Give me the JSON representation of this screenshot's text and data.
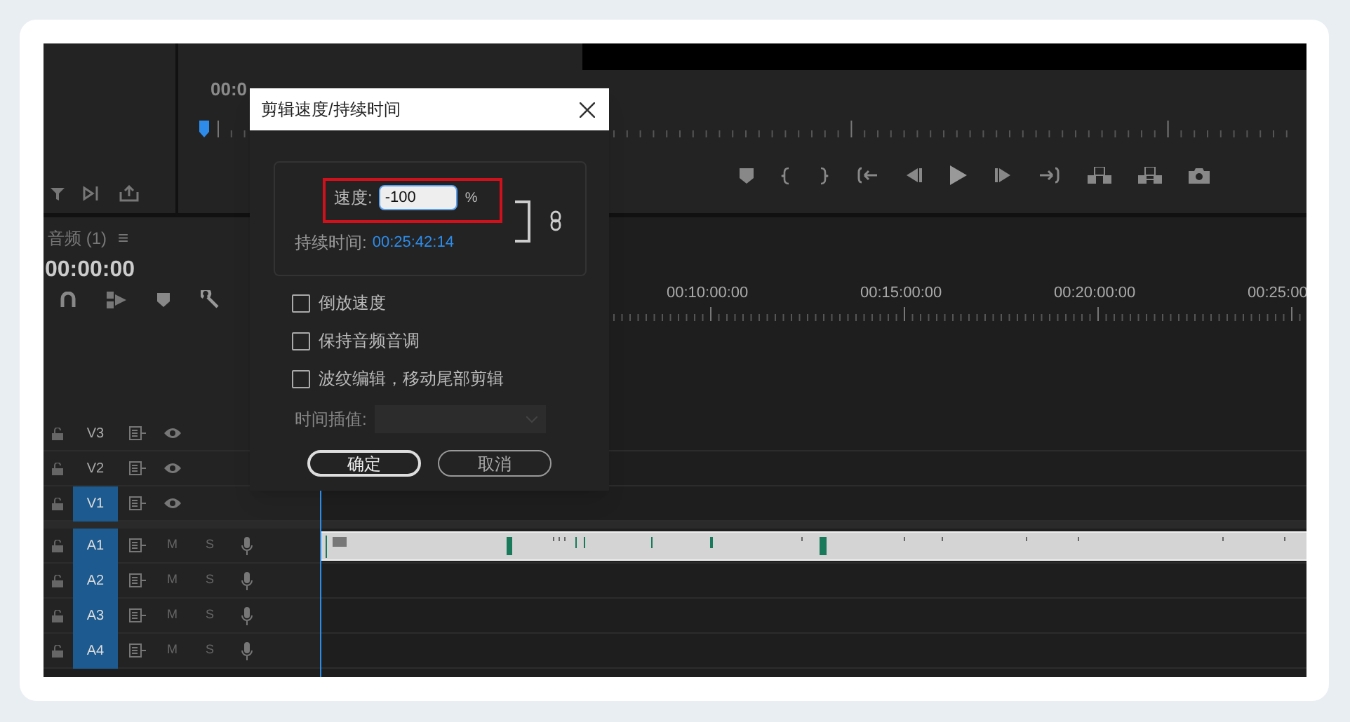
{
  "program_monitor": {
    "timecode": "00:0"
  },
  "timeline": {
    "tab_title": "音频 (1)",
    "menu_glyph": "≡",
    "timecode": "00:00:00",
    "ruler_labels": [
      "00:10:00:00",
      "00:15:00:00",
      "00:20:00:00",
      "00:25:00"
    ],
    "tracks": [
      {
        "name": "V3",
        "kind": "video",
        "selected": false
      },
      {
        "name": "V2",
        "kind": "video",
        "selected": false
      },
      {
        "name": "V1",
        "kind": "video",
        "selected": true
      },
      {
        "name": "A1",
        "kind": "audio",
        "selected": true,
        "mute": "M",
        "solo": "S"
      },
      {
        "name": "A2",
        "kind": "audio",
        "selected": true,
        "mute": "M",
        "solo": "S"
      },
      {
        "name": "A3",
        "kind": "audio",
        "selected": true,
        "mute": "M",
        "solo": "S"
      },
      {
        "name": "A4",
        "kind": "audio",
        "selected": true,
        "mute": "M",
        "solo": "S"
      }
    ]
  },
  "dialog": {
    "title": "剪辑速度/持续时间",
    "speed_label": "速度:",
    "speed_value": "-100",
    "speed_unit": "%",
    "duration_label": "持续时间:",
    "duration_value": "00:25:42:14",
    "options": [
      {
        "label": "倒放速度",
        "checked": false
      },
      {
        "label": "保持音频音调",
        "checked": false
      },
      {
        "label": "波纹编辑，移动尾部剪辑",
        "checked": false
      }
    ],
    "interpolation_label": "时间插值:",
    "interpolation_disabled": true,
    "buttons": [
      {
        "label": "确定",
        "kind": "default"
      },
      {
        "label": "取消",
        "kind": "normal"
      }
    ]
  }
}
